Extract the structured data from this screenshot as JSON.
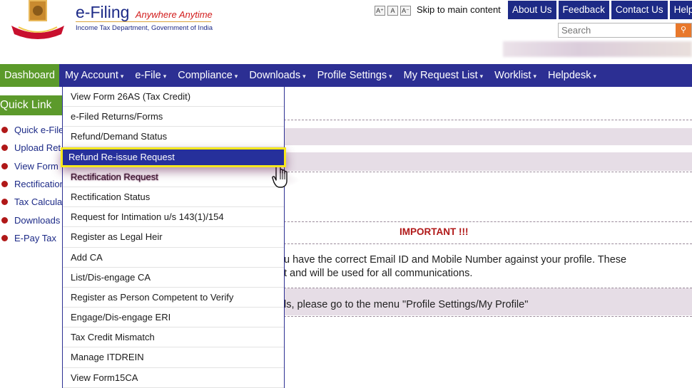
{
  "header": {
    "brand": "e-Filing",
    "tagline": "Anywhere Anytime",
    "department": "Income Tax Department, Government of India",
    "font_buttons": [
      "A⁺",
      "A",
      "A⁻"
    ],
    "skip_link": "Skip to main content",
    "top_links": [
      "About Us",
      "Feedback",
      "Contact Us",
      "Help"
    ],
    "search_placeholder": "Search"
  },
  "nav": {
    "dashboard": "Dashboard",
    "items": [
      "My Account",
      "e-File",
      "Compliance",
      "Downloads",
      "Profile Settings",
      "My Request List",
      "Worklist",
      "Helpdesk"
    ]
  },
  "quick_links": {
    "title": "Quick Link",
    "items": [
      "Quick e-File",
      "Upload Ret",
      "View Form",
      "Rectification",
      "Tax Calcula",
      "Downloads",
      "E-Pay Tax"
    ]
  },
  "dropdown": {
    "items": [
      "View Form 26AS (Tax Credit)",
      "e-Filed Returns/Forms",
      "Refund/Demand Status",
      "Refund Re-issue Request",
      "Rectification Request",
      "Rectification Status",
      "Request for Intimation u/s 143(1)/154",
      "Register as Legal Heir",
      "Add CA",
      "List/Dis-engage CA",
      "Register as Person Competent to Verify",
      "Engage/Dis-engage ERI",
      "Tax Credit Mismatch",
      "Manage ITDREIN",
      "View Form15CA"
    ],
    "highlighted_index": 3
  },
  "content": {
    "important_title": "IMPORTANT !!!",
    "line1": "u have the correct Email ID and Mobile Number against your profile. These",
    "line2": "t and will be used for all communications.",
    "line3": "ls, please go to the menu \"Profile Settings/My Profile\""
  },
  "colors": {
    "nav_bg": "#2c2f93",
    "dashboard_bg": "#5b9a2a",
    "highlight_border": "#f7e81c",
    "important_red": "#b01818"
  }
}
